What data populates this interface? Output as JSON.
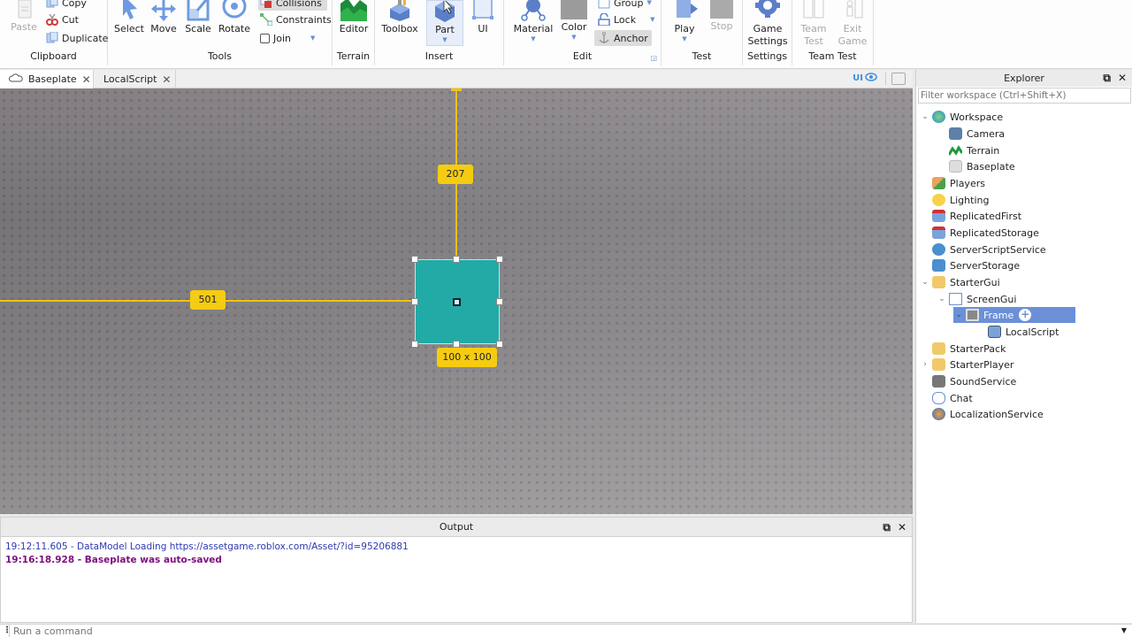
{
  "ribbon": {
    "groups": {
      "clipboard": {
        "label": "Clipboard",
        "paste": "Paste",
        "copy": "Copy",
        "cut": "Cut",
        "duplicate": "Duplicate"
      },
      "tools": {
        "label": "Tools",
        "select": "Select",
        "move": "Move",
        "scale": "Scale",
        "rotate": "Rotate",
        "collisions": "Collisions",
        "constraints": "Constraints",
        "join": "Join"
      },
      "terrain": {
        "label": "Terrain",
        "editor": "Editor"
      },
      "insert": {
        "label": "Insert",
        "toolbox": "Toolbox",
        "part": "Part",
        "ui": "UI"
      },
      "edit": {
        "label": "Edit",
        "material": "Material",
        "color": "Color",
        "group": "Group",
        "lock": "Lock",
        "anchor": "Anchor"
      },
      "test": {
        "label": "Test",
        "play": "Play",
        "stop": "Stop"
      },
      "settings": {
        "label": "Settings",
        "game_settings_1": "Game",
        "game_settings_2": "Settings"
      },
      "team_test": {
        "label": "Team Test",
        "team_test_1": "Team",
        "team_test_2": "Test",
        "exit_game_1": "Exit",
        "exit_game_2": "Game"
      }
    }
  },
  "tabs": [
    {
      "label": "Baseplate",
      "active": true
    },
    {
      "label": "LocalScript",
      "active": false
    }
  ],
  "viewport": {
    "ui_toggle_label": "UI",
    "distance_top": "207",
    "distance_left": "501",
    "frame_size": "100 x 100",
    "frame_color": "#22aaa6",
    "guide_color": "#f2c20e"
  },
  "output": {
    "title": "Output",
    "lines": [
      {
        "text": "19:12:11.605 - DataModel Loading https://assetgame.roblox.com/Asset/?id=95206881",
        "type": "info"
      },
      {
        "text": "19:16:18.928 - Baseplate was auto-saved",
        "type": "warn"
      }
    ]
  },
  "command_bar": {
    "placeholder": "Run a command"
  },
  "explorer": {
    "title": "Explorer",
    "filter_placeholder": "Filter workspace (Ctrl+Shift+X)",
    "items": [
      {
        "label": "Workspace",
        "icon": "workspace-globe-icon",
        "depth": 0,
        "expanded": "open"
      },
      {
        "label": "Camera",
        "icon": "camera-icon",
        "depth": 1
      },
      {
        "label": "Terrain",
        "icon": "terrain-icon",
        "depth": 1
      },
      {
        "label": "Baseplate",
        "icon": "part-brick-icon",
        "depth": 1
      },
      {
        "label": "Players",
        "icon": "players-icon",
        "depth": 0
      },
      {
        "label": "Lighting",
        "icon": "lightbulb-icon",
        "depth": 0
      },
      {
        "label": "ReplicatedFirst",
        "icon": "replicated-icon",
        "depth": 0
      },
      {
        "label": "ReplicatedStorage",
        "icon": "replicated-icon",
        "depth": 0
      },
      {
        "label": "ServerScriptService",
        "icon": "server-script-icon",
        "depth": 0
      },
      {
        "label": "ServerStorage",
        "icon": "server-storage-icon",
        "depth": 0
      },
      {
        "label": "StarterGui",
        "icon": "starter-gui-icon",
        "depth": 0,
        "expanded": "open"
      },
      {
        "label": "ScreenGui",
        "icon": "screen-gui-icon",
        "depth": 1,
        "expanded": "open"
      },
      {
        "label": "Frame",
        "icon": "frame-icon",
        "depth": 2,
        "expanded": "open",
        "selected": true
      },
      {
        "label": "LocalScript",
        "icon": "local-script-icon",
        "depth": 3
      },
      {
        "label": "StarterPack",
        "icon": "starter-pack-icon",
        "depth": 0
      },
      {
        "label": "StarterPlayer",
        "icon": "starter-player-icon",
        "depth": 0,
        "expanded": "closed"
      },
      {
        "label": "SoundService",
        "icon": "speaker-icon",
        "depth": 0
      },
      {
        "label": "Chat",
        "icon": "chat-bubble-icon",
        "depth": 0
      },
      {
        "label": "LocalizationService",
        "icon": "localization-globe-icon",
        "depth": 0
      }
    ]
  }
}
